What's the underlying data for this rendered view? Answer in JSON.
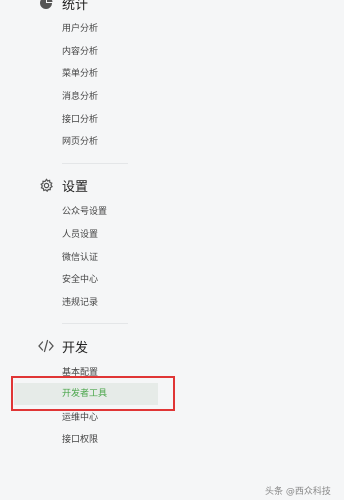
{
  "sections": [
    {
      "title": "统计",
      "icon": "pie-chart-icon",
      "items": [
        "用户分析",
        "内容分析",
        "菜单分析",
        "消息分析",
        "接口分析",
        "网页分析"
      ]
    },
    {
      "title": "设置",
      "icon": "gear-icon",
      "items": [
        "公众号设置",
        "人员设置",
        "微信认证",
        "安全中心",
        "违规记录"
      ]
    },
    {
      "title": "开发",
      "icon": "code-icon",
      "items": [
        "基本配置",
        "开发者工具",
        "运维中心",
        "接口权限"
      ],
      "active_index": 1
    }
  ],
  "colors": {
    "active_text": "#4aa64a",
    "highlight_border": "#e03535"
  },
  "watermark": "头条 @西众科技"
}
